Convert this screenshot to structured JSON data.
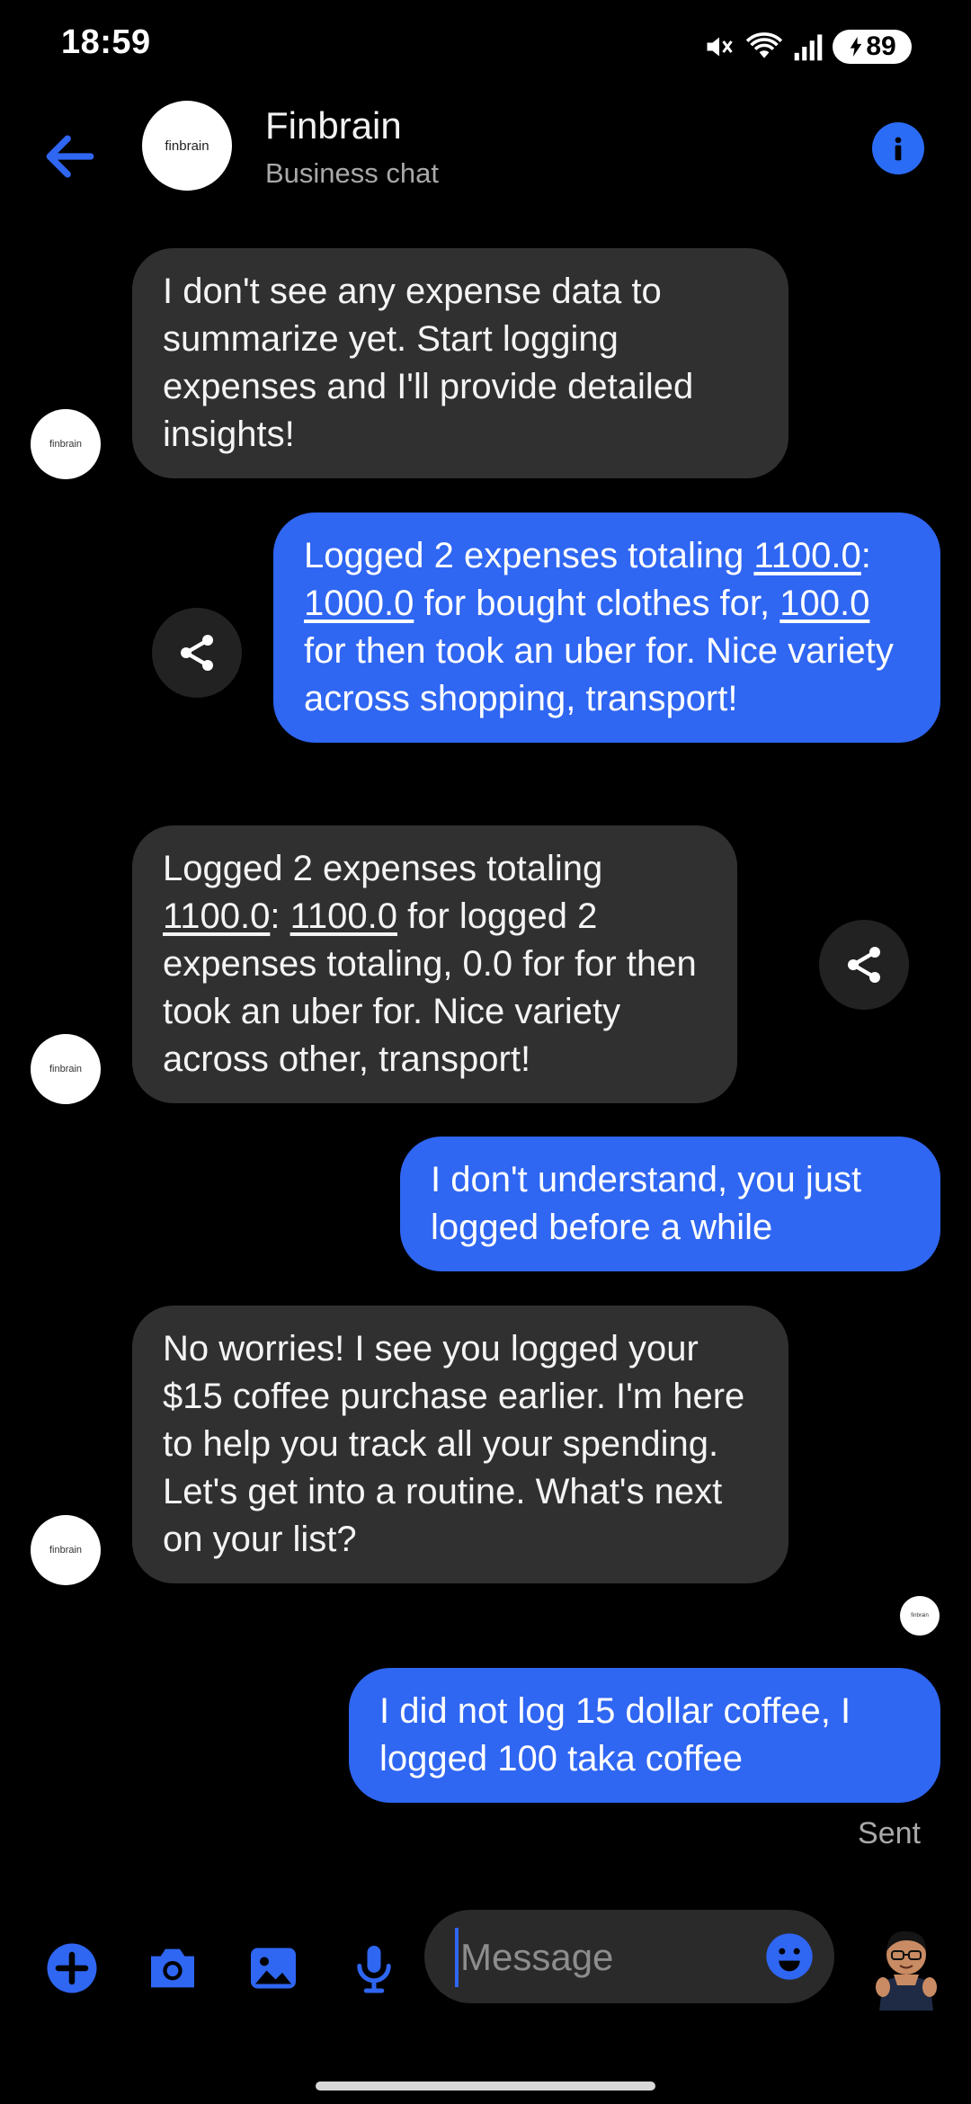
{
  "status_bar": {
    "time": "18:59",
    "battery": "89"
  },
  "header": {
    "title": "Finbrain",
    "subtitle": "Business chat",
    "avatar_text": "finbrain"
  },
  "messages": [
    {
      "id": "m1",
      "direction": "incoming",
      "text": "I don't see any expense data to summarize yet. Start logging expenses and I'll provide detailed insights!"
    },
    {
      "id": "m2",
      "direction": "outgoing",
      "parts": [
        "Logged 2 expenses totaling ",
        "1100.0",
        ": ",
        "1000.0",
        " for bought clothes for, ",
        "100.0",
        " for then took an uber for. Nice variety across shopping, transport!"
      ]
    },
    {
      "id": "m3",
      "direction": "incoming",
      "parts": [
        "Logged 2 expenses totaling ",
        "1100.0",
        ": ",
        "1100.0",
        " for logged 2 expenses totaling, 0.0 for for then took an uber for. Nice variety across other, transport!"
      ]
    },
    {
      "id": "m4",
      "direction": "outgoing",
      "text": "I don't understand, you just logged before a while"
    },
    {
      "id": "m5",
      "direction": "incoming",
      "text": "No worries! I see you logged your $15 coffee purchase earlier. I'm here to help you track all your spending. Let's get into a routine. What's next on your list?"
    },
    {
      "id": "m6",
      "direction": "outgoing",
      "text": "I did not log 15 dollar coffee, I logged 100 taka coffee"
    }
  ],
  "avatar_label": "finbrain",
  "sent_status": "Sent",
  "composer": {
    "placeholder": "Message"
  },
  "colors": {
    "accent": "#2f66f2",
    "incoming_bubble": "#303030",
    "background": "#000000"
  },
  "icons": [
    "back-arrow-icon",
    "info-icon",
    "share-icon",
    "plus-icon",
    "camera-icon",
    "gallery-icon",
    "microphone-icon",
    "emoji-icon",
    "avatar-sticker-icon"
  ]
}
